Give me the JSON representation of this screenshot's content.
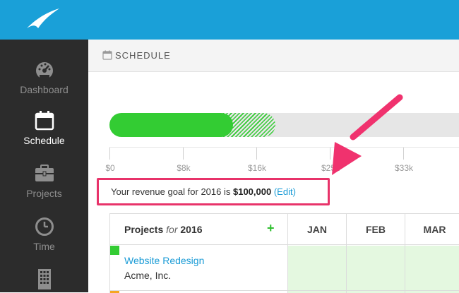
{
  "sidebar": {
    "items": [
      {
        "label": "Dashboard",
        "icon": "gauge-icon",
        "active": false
      },
      {
        "label": "Schedule",
        "icon": "calendar-icon",
        "active": true
      },
      {
        "label": "Projects",
        "icon": "briefcase-icon",
        "active": false
      },
      {
        "label": "Time",
        "icon": "clock-icon",
        "active": false
      },
      {
        "label": "",
        "icon": "building-icon",
        "active": false
      }
    ]
  },
  "header": {
    "title": "SCHEDULE"
  },
  "revenue_bar": {
    "filled_fraction": 0.35,
    "projected_fraction": 0.47
  },
  "axis": {
    "ticks": [
      "$0",
      "$8k",
      "$16k",
      "$25k",
      "$33k"
    ]
  },
  "goal": {
    "prefix": "Your revenue goal for 2016 is ",
    "amount": "$100,000",
    "edit_label": "(Edit)"
  },
  "grid": {
    "projects_label": "Projects",
    "for_label": "for",
    "year": "2016",
    "add_label": "+",
    "months": [
      "JAN",
      "FEB",
      "MAR"
    ],
    "rows": [
      {
        "name": "Website Redesign",
        "client": "Acme, Inc."
      }
    ]
  },
  "colors": {
    "brand": "#1aa0d8",
    "progress": "#33cc33",
    "highlight": "#e8336a",
    "link": "#1a9bd6"
  }
}
